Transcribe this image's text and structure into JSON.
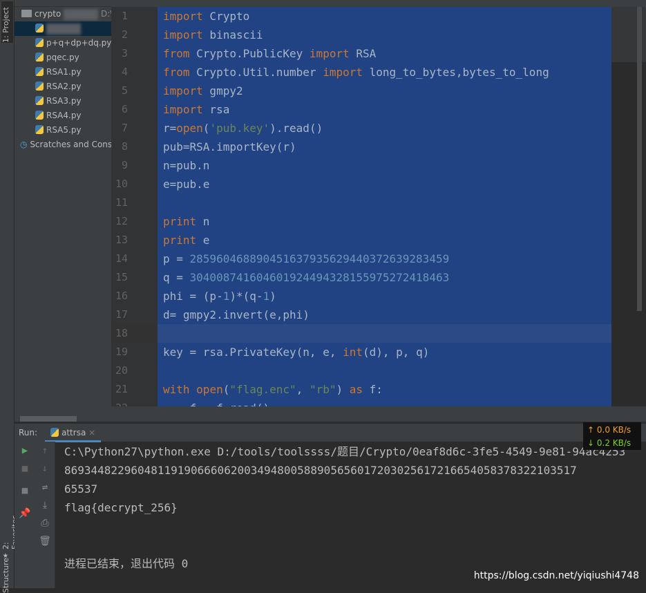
{
  "left_strip": {
    "project_tab": "1: Project",
    "favorites_tab": "2: Favorites",
    "structure_tab": "Structure"
  },
  "project": {
    "root": "crypto",
    "root_path": "D:\\",
    "files": [
      "p+q+dp+dq.py",
      "pqec.py",
      "RSA1.py",
      "RSA2.py",
      "RSA3.py",
      "RSA4.py",
      "RSA5.py"
    ],
    "scratches": "Scratches and Consoles"
  },
  "editor": {
    "current_line": 18,
    "lines": [
      [
        [
          "import",
          "k"
        ],
        [
          " Crypto",
          "t"
        ]
      ],
      [
        [
          "import",
          "k"
        ],
        [
          " binascii",
          "t"
        ]
      ],
      [
        [
          "from",
          "k"
        ],
        [
          " Crypto.PublicKey ",
          "t"
        ],
        [
          "import",
          "k"
        ],
        [
          " RSA",
          "t"
        ]
      ],
      [
        [
          "from",
          "k"
        ],
        [
          " Crypto.Util.number ",
          "t"
        ],
        [
          "import",
          "k"
        ],
        [
          " long_to_bytes,bytes_to_long",
          "t"
        ]
      ],
      [
        [
          "import",
          "k"
        ],
        [
          " gmpy2",
          "t"
        ]
      ],
      [
        [
          "import",
          "k"
        ],
        [
          " rsa",
          "t"
        ]
      ],
      [
        [
          "r=",
          "t"
        ],
        [
          "open",
          "k"
        ],
        [
          "(",
          "t"
        ],
        [
          "'pub.key'",
          "s"
        ],
        [
          ").read()",
          "t"
        ]
      ],
      [
        [
          "pub=RSA.importKey(r)",
          "t"
        ]
      ],
      [
        [
          "n=pub.n",
          "t"
        ]
      ],
      [
        [
          "e=pub.e",
          "t"
        ]
      ],
      [],
      [
        [
          "print",
          "k"
        ],
        [
          " n",
          "t"
        ]
      ],
      [
        [
          "print",
          "k"
        ],
        [
          " e",
          "t"
        ]
      ],
      [
        [
          "p = ",
          "t"
        ],
        [
          "285960468890451637935629440372639283459",
          "n"
        ]
      ],
      [
        [
          "q = ",
          "t"
        ],
        [
          "304008741604601924494328155975272418463",
          "n"
        ]
      ],
      [
        [
          "phi = (p-",
          "t"
        ],
        [
          "1",
          "n"
        ],
        [
          ")*(q-",
          "t"
        ],
        [
          "1",
          "n"
        ],
        [
          ")",
          "t"
        ]
      ],
      [
        [
          "d= gmpy2.invert(e,phi)",
          "t"
        ]
      ],
      [],
      [
        [
          "key = rsa.PrivateKey(n, e, ",
          "t"
        ],
        [
          "int",
          "k"
        ],
        [
          "(d), p, q)",
          "t"
        ]
      ],
      [],
      [
        [
          "with",
          "k"
        ],
        [
          " ",
          "t"
        ],
        [
          "open",
          "k"
        ],
        [
          "(",
          "t"
        ],
        [
          "\"flag.enc\"",
          "s"
        ],
        [
          ", ",
          "t"
        ],
        [
          "\"rb\"",
          "s"
        ],
        [
          ") ",
          "t"
        ],
        [
          "as",
          "k"
        ],
        [
          " f:",
          "t"
        ]
      ],
      [
        [
          "    f = f.read()",
          "t"
        ]
      ]
    ]
  },
  "run": {
    "label": "Run:",
    "tab": "attrsa",
    "output": [
      "C:\\Python27\\python.exe D:/tools/toolssss/题目/Crypto/0eaf8d6c-3fe5-4549-9e81-94ac4253",
      "86934482296048119190666062003494800588905656017203025617216654058378322103517",
      "65537",
      "flag{decrypt_256}",
      "",
      "",
      "进程已结束，退出代码 0"
    ]
  },
  "network": {
    "up": "↑ 0.0 KB/s",
    "down": "↓ 0.2 KB/s",
    "up_color": "#f0a030",
    "down_color": "#7ed321"
  },
  "watermark": "https://blog.csdn.net/yiqiushi4748"
}
